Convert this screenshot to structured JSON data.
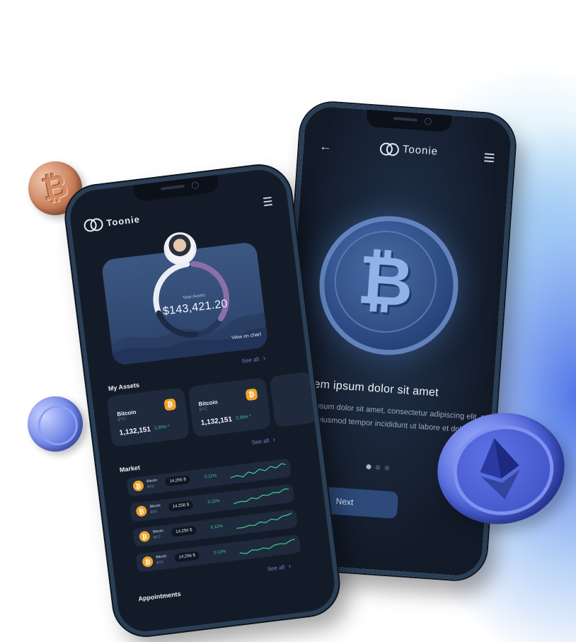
{
  "brand": {
    "name": "Toonie"
  },
  "onboarding": {
    "title": "Lorem ipsum dolor sit amet",
    "description": "Lorem ipsum dolor sit amet, consectetur adipiscing elit, sed do eiusmod tempor incididunt ut labore et dolore.",
    "next_label": "Next",
    "page_dots": 3,
    "active_dot": 0
  },
  "dashboard": {
    "total_assets_label": "Total Assets",
    "total_assets_value": "$143,421.20",
    "view_on_chart_label": "View on chart",
    "see_all_label": "See all",
    "my_assets_title": "My Assets",
    "market_title": "Market",
    "appointments_title": "Appointments",
    "assets": [
      {
        "name": "Bitcoin",
        "symbol": "BTC",
        "price": "1,132,151",
        "change": "2,35%"
      },
      {
        "name": "Bitcoin",
        "symbol": "BTC",
        "price": "1,132,151",
        "change": "2,35%"
      }
    ],
    "market": [
      {
        "name": "Bitcoin",
        "symbol": "BTC",
        "price": "14,256 $",
        "change": "0.12%"
      },
      {
        "name": "Bitcoin",
        "symbol": "BTC",
        "price": "14,256 $",
        "change": "0.12%"
      },
      {
        "name": "Bitcoin",
        "symbol": "BTC",
        "price": "14,256 $",
        "change": "0.12%"
      },
      {
        "name": "Bitcoin",
        "symbol": "BTC",
        "price": "14,256 $",
        "change": "0.12%"
      }
    ]
  },
  "colors": {
    "accent": "#6a87c9",
    "positive": "#3fd08a",
    "bitcoin": "#f0a32c",
    "phone_bg": "#141b28"
  },
  "icons": {
    "back": "arrow-left-icon",
    "menu": "hamburger-menu-icon",
    "coin": "bitcoin-icon",
    "chevron": "chevron-right-icon"
  }
}
